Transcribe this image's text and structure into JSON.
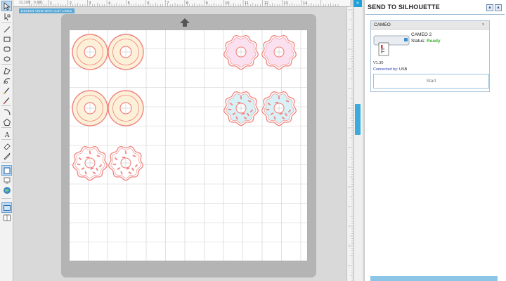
{
  "ruler": {
    "coords": "11.109 , 0.981",
    "ticks": [
      "3",
      "1",
      "2",
      "3",
      "4",
      "5",
      "6",
      "7",
      "8",
      "9",
      "10",
      "11",
      "12",
      "13",
      "14"
    ],
    "design_tab": "DESIGN VIEW WITH CUT LINES"
  },
  "toolbar": {
    "icons": [
      "pointer-icon",
      "edit-points-icon",
      "line-icon",
      "rectangle-icon",
      "rounded-rectangle-icon",
      "ellipse-icon",
      "polygon-icon",
      "curve-icon",
      "freehand-icon",
      "smooth-freehand-icon",
      "arc-icon",
      "regular-polygon-icon",
      "text-icon",
      "eraser-icon",
      "knife-icon",
      "page-view-icon",
      "cut-view-icon",
      "library-icon",
      "store-icon",
      "send-icon"
    ]
  },
  "panel": {
    "title": "SEND TO SILHOUETTE",
    "up_label": "▲",
    "collapse_label": "▲",
    "device_header": "CAMEO",
    "close_label": "x",
    "device_name": "CAMEO 2",
    "status_label": "Status:",
    "status_value": "Ready",
    "version": "V1.30",
    "connected_label": "Connected by:",
    "connected_value": "USB",
    "start_label": "Start"
  },
  "colors": {
    "accent": "#1fa0d8",
    "ready": "#3cb034",
    "donut_stroke": "#f0837e",
    "donut_plain_fill": "#fdf0d8",
    "donut_pink_fill": "#fbe0ef",
    "donut_blue_fill": "#d7f1f7",
    "sprinkle": "#f28a8a"
  },
  "mat": {
    "donuts": [
      {
        "row": 1,
        "col": 1,
        "kind": "plain"
      },
      {
        "row": 1,
        "col": 2,
        "kind": "plain"
      },
      {
        "row": 1,
        "col": 3,
        "kind": "wavy-pink"
      },
      {
        "row": 1,
        "col": 4,
        "kind": "wavy-pink"
      },
      {
        "row": 2,
        "col": 1,
        "kind": "plain"
      },
      {
        "row": 2,
        "col": 2,
        "kind": "plain"
      },
      {
        "row": 2,
        "col": 3,
        "kind": "wavy-blue-sprinkles"
      },
      {
        "row": 2,
        "col": 4,
        "kind": "wavy-blue-sprinkles"
      },
      {
        "row": 3,
        "col": 1,
        "kind": "wavy-white-sprinkles"
      },
      {
        "row": 3,
        "col": 2,
        "kind": "wavy-white-sprinkles"
      }
    ]
  }
}
